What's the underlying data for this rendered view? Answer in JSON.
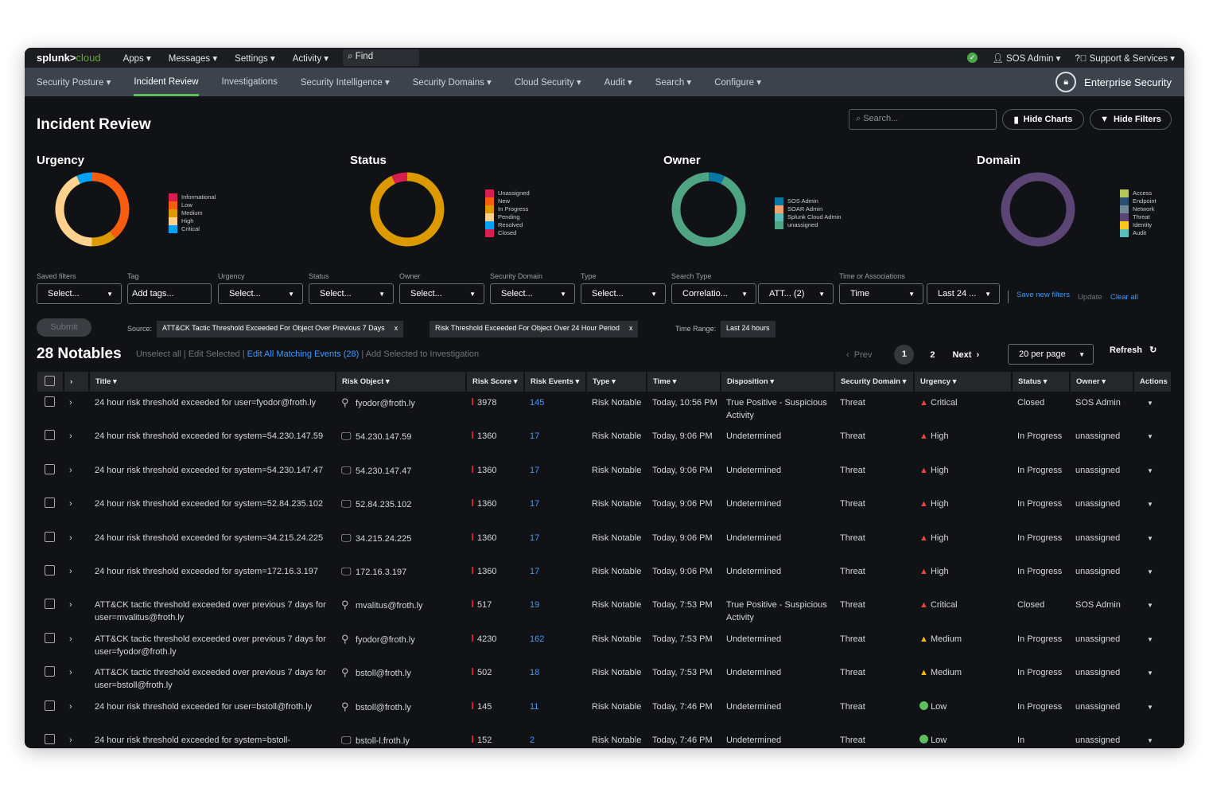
{
  "topbar": {
    "logo_a": "splunk>",
    "logo_b": "cloud",
    "menus": [
      "Apps ▾",
      "Messages ▾",
      "Settings ▾",
      "Activity ▾"
    ],
    "find": "Find",
    "user": "SOS Admin ▾",
    "support": "Support & Services ▾",
    "status_color": "#4aa84a"
  },
  "nav": {
    "items": [
      "Security Posture ▾",
      "Incident Review",
      "Investigations",
      "Security Intelligence ▾",
      "Security Domains ▾",
      "Cloud Security ▾",
      "Audit ▾",
      "Search ▾",
      "Configure ▾"
    ],
    "active": 1,
    "app": "Enterprise Security"
  },
  "page": {
    "title": "Incident Review",
    "search_placeholder": "Search...",
    "hide_charts": "Hide Charts",
    "hide_filters": "Hide Filters"
  },
  "charts": [
    {
      "title": "Urgency",
      "legend": [
        [
          "Informational",
          "#d81e4e"
        ],
        [
          "Low",
          "#f85d0f"
        ],
        [
          "Medium",
          "#dc9a00"
        ],
        [
          "High",
          "#fdd28d"
        ],
        [
          "Critical",
          "#00a3f5"
        ]
      ],
      "values": [
        0,
        11,
        3,
        12,
        2
      ]
    },
    {
      "title": "Status",
      "legend": [
        [
          "Unassigned",
          "#d81e4e"
        ],
        [
          "New",
          "#f85d0f"
        ],
        [
          "In Progress",
          "#dc9a00"
        ],
        [
          "Pending",
          "#fdd28d"
        ],
        [
          "Resolved",
          "#00a3f5"
        ],
        [
          "Closed",
          "#d81e4e"
        ]
      ],
      "values": [
        0,
        0,
        26,
        0,
        0,
        2
      ]
    },
    {
      "title": "Owner",
      "legend": [
        [
          "SOS Admin",
          "#0877a6"
        ],
        [
          "SOAR Admin",
          "#f4a06a"
        ],
        [
          "Splunk Cloud Admin",
          "#5bbcbc"
        ],
        [
          "unassigned",
          "#4fa484"
        ]
      ],
      "values": [
        2,
        0,
        0,
        26
      ]
    },
    {
      "title": "Domain",
      "legend": [
        [
          "Access",
          "#b6c75a"
        ],
        [
          "Endpoint",
          "#294e70"
        ],
        [
          "Network",
          "#708794"
        ],
        [
          "Threat",
          "#5a4575"
        ],
        [
          "Identity",
          "#fac51c"
        ],
        [
          "Audit",
          "#5bbcbc"
        ]
      ],
      "values": [
        0,
        0,
        0,
        28,
        0,
        0
      ]
    }
  ],
  "filters": [
    {
      "label": "Saved filters",
      "value": "Select..."
    },
    {
      "label": "Tag",
      "value": "Add tags..."
    },
    {
      "label": "Urgency",
      "value": "Select..."
    },
    {
      "label": "Status",
      "value": "Select..."
    },
    {
      "label": "Owner",
      "value": "Select..."
    },
    {
      "label": "Security Domain",
      "value": "Select..."
    },
    {
      "label": "Type",
      "value": "Select..."
    },
    {
      "label": "Search Type",
      "value": "Correlatio..."
    },
    {
      "label": "",
      "value": "ATT...   (2)"
    },
    {
      "label": "Time or Associations",
      "value": "Time"
    },
    {
      "label": "",
      "value": "Last 24 ..."
    }
  ],
  "filter_links": {
    "save": "Save new filters",
    "update": "Update",
    "clear": "Clear all"
  },
  "submit": "Submit",
  "source_label": "Source:",
  "sources": [
    "ATT&CK Tactic Threshold Exceeded For Object Over Previous 7 Days",
    "Risk Threshold Exceeded For Object Over 24 Hour Period"
  ],
  "remove": "x",
  "time_range_label": "Time Range:",
  "time_range": "Last 24 hours",
  "notables": {
    "count": "28 Notables",
    "unselect": "Unselect all",
    "edit_selected": "Edit Selected",
    "edit_all": "Edit All Matching Events (28)",
    "add_inv": "Add Selected to Investigation",
    "sep": "|"
  },
  "pager": {
    "prev": "Prev",
    "pages": [
      "1",
      "2"
    ],
    "next": "Next",
    "per_page": "20 per page",
    "refresh": "Refresh"
  },
  "columns": [
    "Title ▾",
    "Risk Object ▾",
    "Risk Score ▾",
    "Risk Events ▾",
    "Type ▾",
    "Time ▾",
    "Disposition ▾",
    "Security Domain ▾",
    "Urgency ▾",
    "Status ▾",
    "Owner ▾",
    "Actions"
  ],
  "rows": [
    {
      "title": "24 hour risk threshold exceeded for user=fyodor@froth.ly",
      "obj": "fyodor@froth.ly",
      "otype": "user",
      "score": "3978",
      "events": "145",
      "type": "Risk Notable",
      "time": "Today, 10:56 PM",
      "disp": "True Positive - Suspicious Activity",
      "domain": "Threat",
      "urgency": "Critical",
      "status": "Closed",
      "owner": "SOS Admin"
    },
    {
      "title": "24 hour risk threshold exceeded for system=54.230.147.59",
      "obj": "54.230.147.59",
      "otype": "system",
      "score": "1360",
      "events": "17",
      "type": "Risk Notable",
      "time": "Today, 9:06 PM",
      "disp": "Undetermined",
      "domain": "Threat",
      "urgency": "High",
      "status": "In Progress",
      "owner": "unassigned"
    },
    {
      "title": "24 hour risk threshold exceeded for system=54.230.147.47",
      "obj": "54.230.147.47",
      "otype": "system",
      "score": "1360",
      "events": "17",
      "type": "Risk Notable",
      "time": "Today, 9:06 PM",
      "disp": "Undetermined",
      "domain": "Threat",
      "urgency": "High",
      "status": "In Progress",
      "owner": "unassigned"
    },
    {
      "title": "24 hour risk threshold exceeded for system=52.84.235.102",
      "obj": "52.84.235.102",
      "otype": "system",
      "score": "1360",
      "events": "17",
      "type": "Risk Notable",
      "time": "Today, 9:06 PM",
      "disp": "Undetermined",
      "domain": "Threat",
      "urgency": "High",
      "status": "In Progress",
      "owner": "unassigned"
    },
    {
      "title": "24 hour risk threshold exceeded for system=34.215.24.225",
      "obj": "34.215.24.225",
      "otype": "system",
      "score": "1360",
      "events": "17",
      "type": "Risk Notable",
      "time": "Today, 9:06 PM",
      "disp": "Undetermined",
      "domain": "Threat",
      "urgency": "High",
      "status": "In Progress",
      "owner": "unassigned"
    },
    {
      "title": "24 hour risk threshold exceeded for system=172.16.3.197",
      "obj": "172.16.3.197",
      "otype": "system",
      "score": "1360",
      "events": "17",
      "type": "Risk Notable",
      "time": "Today, 9:06 PM",
      "disp": "Undetermined",
      "domain": "Threat",
      "urgency": "High",
      "status": "In Progress",
      "owner": "unassigned"
    },
    {
      "title": "ATT&CK tactic threshold exceeded over previous 7 days for user=mvalitus@froth.ly",
      "obj": "mvalitus@froth.ly",
      "otype": "user",
      "score": "517",
      "events": "19",
      "type": "Risk Notable",
      "time": "Today, 7:53 PM",
      "disp": "True Positive - Suspicious Activity",
      "domain": "Threat",
      "urgency": "Critical",
      "status": "Closed",
      "owner": "SOS Admin"
    },
    {
      "title": "ATT&CK tactic threshold exceeded over previous 7 days for user=fyodor@froth.ly",
      "obj": "fyodor@froth.ly",
      "otype": "user",
      "score": "4230",
      "events": "162",
      "type": "Risk Notable",
      "time": "Today, 7:53 PM",
      "disp": "Undetermined",
      "domain": "Threat",
      "urgency": "Medium",
      "status": "In Progress",
      "owner": "unassigned"
    },
    {
      "title": "ATT&CK tactic threshold exceeded over previous 7 days for user=bstoll@froth.ly",
      "obj": "bstoll@froth.ly",
      "otype": "user",
      "score": "502",
      "events": "18",
      "type": "Risk Notable",
      "time": "Today, 7:53 PM",
      "disp": "Undetermined",
      "domain": "Threat",
      "urgency": "Medium",
      "status": "In Progress",
      "owner": "unassigned"
    },
    {
      "title": "24 hour risk threshold exceeded for user=bstoll@froth.ly",
      "obj": "bstoll@froth.ly",
      "otype": "user",
      "score": "145",
      "events": "11",
      "type": "Risk Notable",
      "time": "Today, 7:46 PM",
      "disp": "Undetermined",
      "domain": "Threat",
      "urgency": "Low",
      "status": "In Progress",
      "owner": "unassigned"
    },
    {
      "title": "24 hour risk threshold exceeded for system=bstoll-",
      "obj": "bstoll-l.froth.ly",
      "otype": "system",
      "score": "152",
      "events": "2",
      "type": "Risk Notable",
      "time": "Today, 7:46 PM",
      "disp": "Undetermined",
      "domain": "Threat",
      "urgency": "Low",
      "status": "In",
      "owner": "unassigned"
    }
  ]
}
